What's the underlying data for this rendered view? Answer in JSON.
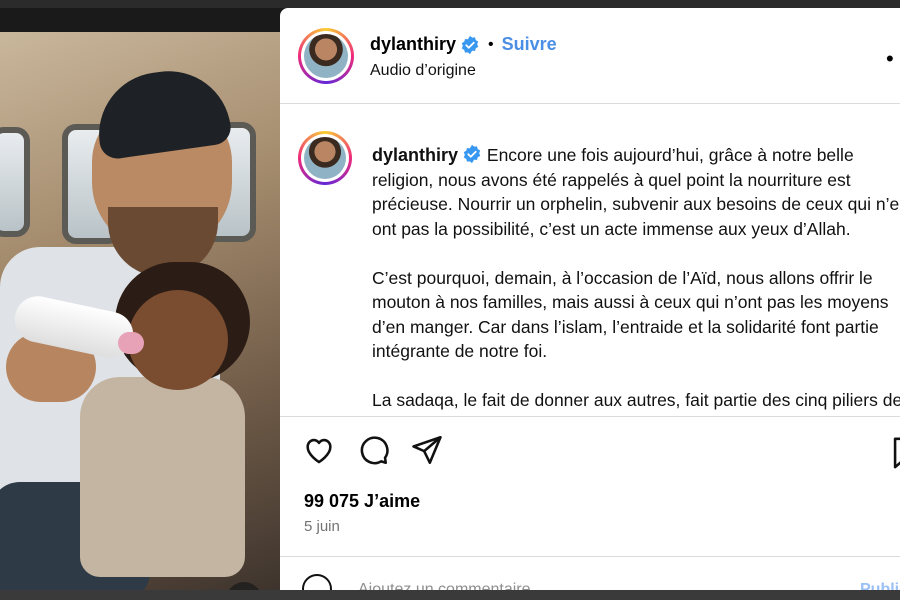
{
  "post": {
    "username": "dylanthiry",
    "follow_label": "Suivre",
    "audio_label": "Audio d’origine",
    "more_label": "•",
    "caption_paragraphs": [
      "Encore une fois aujourd’hui, grâce à notre belle religion, nous avons été rappelés à quel point la nourriture est précieuse. Nourrir un orphelin, subvenir aux besoins de ceux qui n’en ont pas la possibilité, c’est un acte immense aux yeux d’Allah.",
      "C’est pourquoi, demain, à l’occasion de l’Aïd, nous allons offrir le mouton à nos familles, mais aussi à ceux qui n’ont pas les moyens d’en manger. Car dans l’islam, l’entraide et la solidarité font partie intégrante de notre foi.",
      "La sadaqa, le fait de donner aux autres, fait partie des cinq piliers de l’islam."
    ],
    "likes": "99 075 J’aime",
    "date": "5 juin",
    "comment_placeholder": "Ajoutez un commentaire...",
    "publish_label": "Publier"
  },
  "icons": {
    "verified": "verified-badge-icon",
    "like": "heart-icon",
    "comment": "comment-bubble-icon",
    "share": "paper-plane-icon",
    "save": "bookmark-icon",
    "mute": "speaker-muted-icon",
    "emoji": "emoji-icon"
  },
  "colors": {
    "accent": "#4a8ee6",
    "verified": "#3897f0"
  }
}
